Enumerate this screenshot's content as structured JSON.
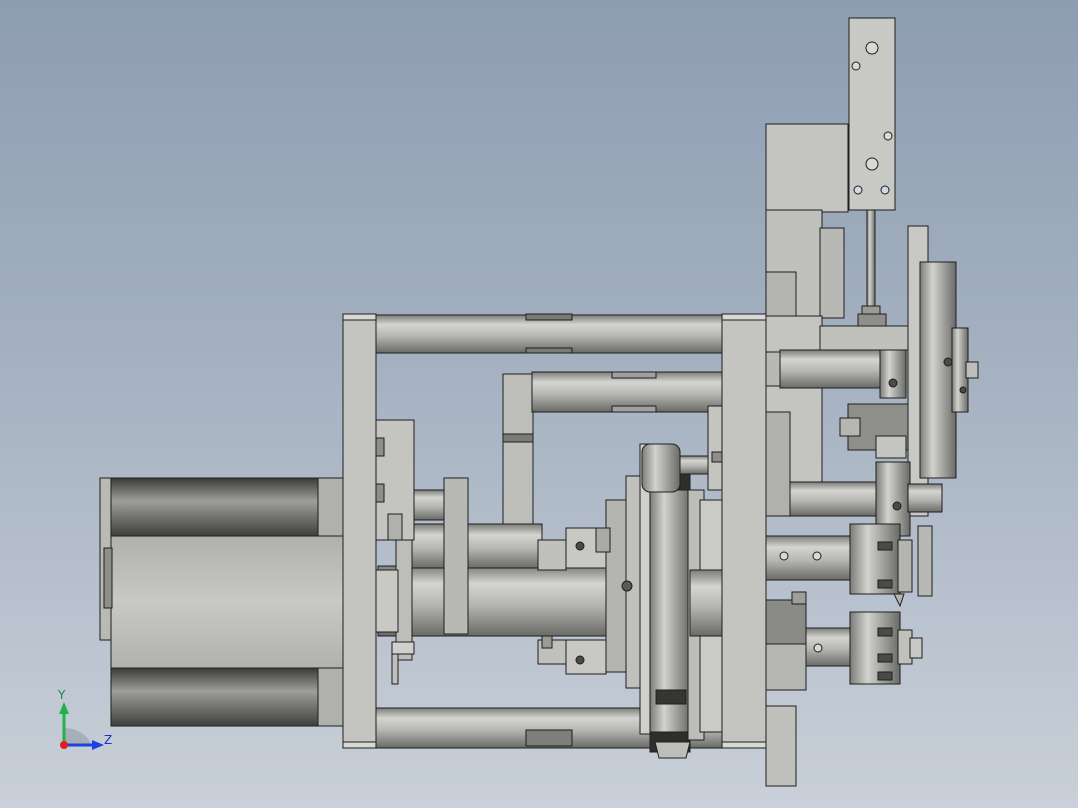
{
  "viewport": {
    "background_top": "#8d9db1",
    "background_bottom": "#c9d0d9"
  },
  "triad": {
    "y_label": "Y",
    "z_label": "Z",
    "y_color": "#22b14c",
    "z_color": "#2040e0",
    "x_color": "#e02020"
  },
  "colors": {
    "part_light": "#c9c9c6",
    "part_mid": "#a9a9a5",
    "part_dark": "#6f6f6c",
    "edge": "#1e1e1e"
  }
}
